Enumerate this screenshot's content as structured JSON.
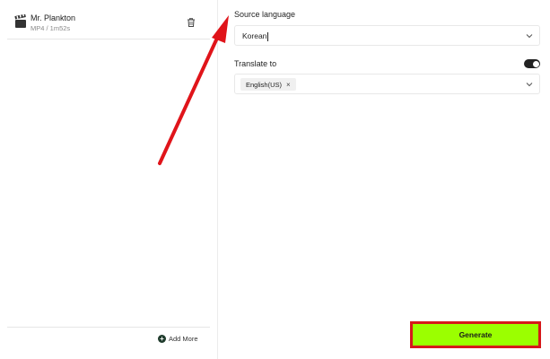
{
  "file": {
    "name": "Mr. Plankton",
    "meta": "MP4 / 1m52s",
    "icon": "clapperboard-icon"
  },
  "left_footer": {
    "add_more_label": "Add More",
    "add_icon": "plus-circle-icon"
  },
  "source_language": {
    "label": "Source language",
    "value": "Korean"
  },
  "translate_to": {
    "label": "Translate to",
    "enabled": true,
    "chips": [
      {
        "label": "English(US)",
        "remove_glyph": "×"
      }
    ]
  },
  "generate": {
    "label": "Generate"
  },
  "colors": {
    "accent_green": "#9bff00",
    "highlight_red": "#d6181a",
    "toggle_on": "#222222"
  }
}
